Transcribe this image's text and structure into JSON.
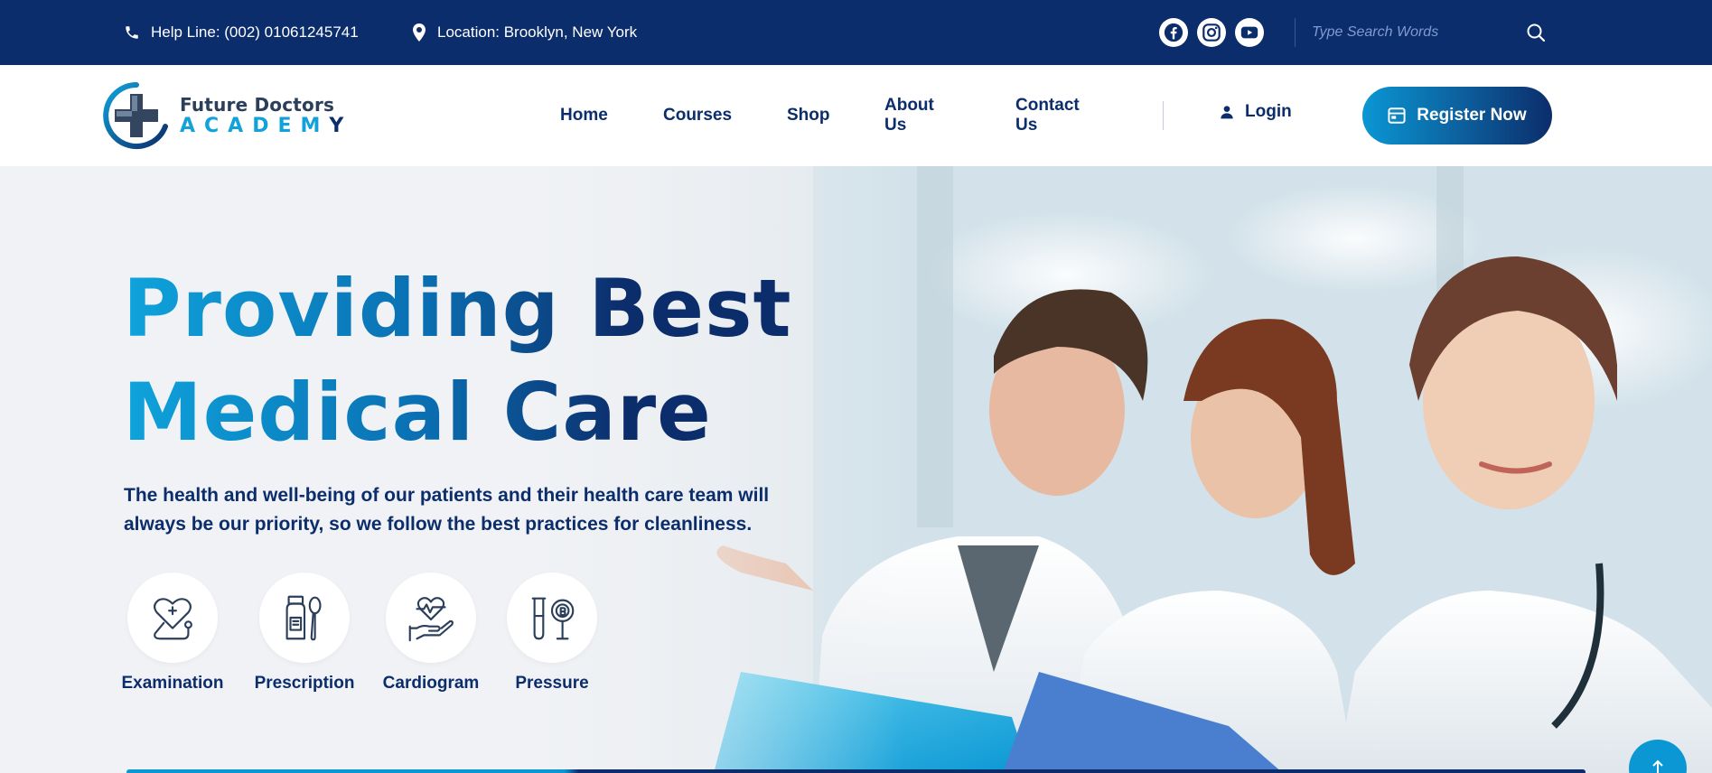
{
  "topbar": {
    "help_line": "Help Line: (002) 01061245741",
    "location": "Location: Brooklyn, New York",
    "search_placeholder": "Type Search Words",
    "socials": [
      "facebook-icon",
      "instagram-icon",
      "youtube-icon"
    ]
  },
  "logo": {
    "line1": "Future Doctors",
    "line2": "ACADEM",
    "line2_last": "Y"
  },
  "nav": {
    "items": [
      {
        "label": "Home"
      },
      {
        "label": "Courses"
      },
      {
        "label": "Shop"
      },
      {
        "label": "About Us"
      },
      {
        "label": "Contact Us"
      }
    ],
    "login": "Login",
    "register": "Register Now"
  },
  "hero": {
    "title_line1": "Providing Best",
    "title_line2": "Medical Care",
    "description": "The health and well-being of our patients and their health care team will always be our priority, so we follow the best practices for cleanliness.",
    "features": [
      {
        "label": "Examination",
        "icon": "stethoscope-heart-icon"
      },
      {
        "label": "Prescription",
        "icon": "medicine-bottle-icon"
      },
      {
        "label": "Cardiogram",
        "icon": "hand-heart-icon"
      },
      {
        "label": "Pressure",
        "icon": "test-tube-icon"
      }
    ]
  },
  "colors": {
    "navy": "#0c2d6b",
    "accent": "#0b97d4"
  }
}
